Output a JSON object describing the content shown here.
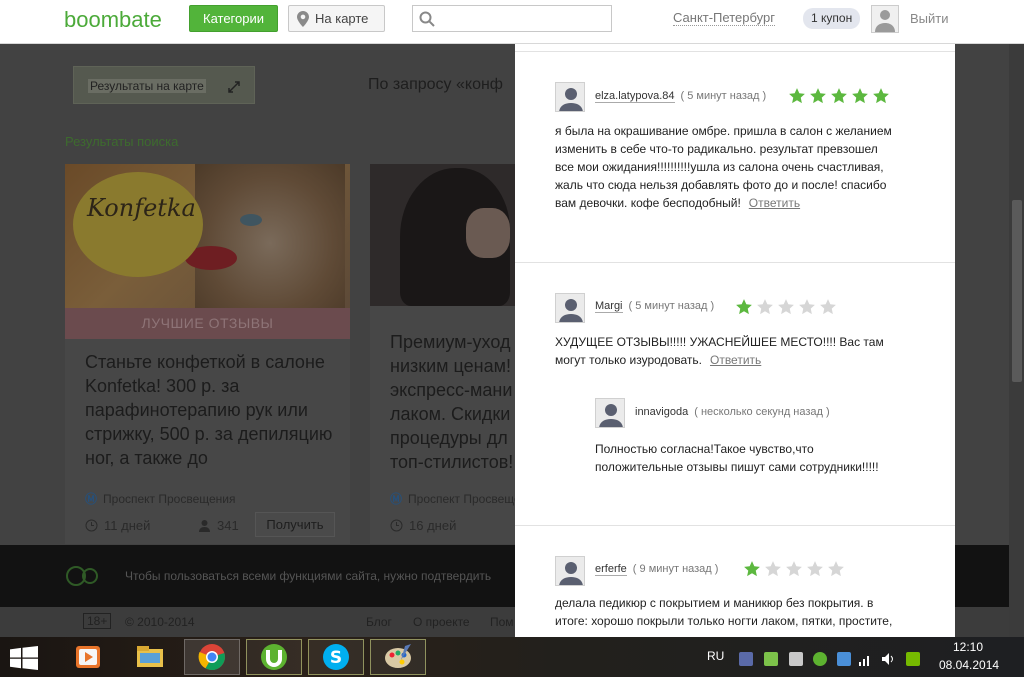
{
  "header": {
    "logo": "boombate",
    "categories_button": "Категории",
    "map_button": "На карте",
    "search_placeholder": "",
    "city": "Санкт-Петербург",
    "coupon": "1 купон",
    "logout": "Выйти",
    "accent_color": "#52b43a"
  },
  "background_page": {
    "map_label": "Результаты на карте",
    "query_text": "По запросу «конф",
    "results_label": "Результаты поиска",
    "cards": [
      {
        "badge": "ЛУЧШИЕ ОТЗЫВЫ",
        "image_text": "Konfetka",
        "title": "Станьте конфеткой в салоне Konfetka! 300 р. за парафинотерапию рук или стрижку, 500 р. за депиляцию ног, а также до",
        "metro": "Проспект Просвещения",
        "days": "11 дней",
        "count": "341",
        "button": "Получить"
      },
      {
        "title_lines": [
          "Премиум-уход",
          "низким ценам!",
          "экспресс-мани",
          "лаком. Скидки",
          "процедуры дл",
          "топ-стилистов!"
        ],
        "metro": "Проспект Просвеще",
        "days": "16 дней"
      }
    ],
    "confirm_text": "Чтобы пользоваться всеми функциями сайта, нужно подтвердить",
    "footer": {
      "age": "18+",
      "copyright": "© 2010-2014",
      "links": [
        "Блог",
        "О проекте",
        "Пом"
      ]
    }
  },
  "reviews": [
    {
      "user": "elza.latypova.84",
      "time": "( 5 минут назад )",
      "rating": 5,
      "lines": [
        "я была на окрашивание омбре. пришла в салон с желанием",
        "изменить в себе что-то радикально. результат превзошел",
        "все мои ожидания!!!!!!!!!!ушла из салона очень счастливая,",
        "жаль что сюда нельзя добавлять фото до и после! спасибо",
        "вам девочки. кофе бесподобный!"
      ],
      "reply": "Ответить"
    },
    {
      "user": "Margi",
      "time": "( 5 минут назад )",
      "rating": 1,
      "lines": [
        "ХУДУЩЕЕ ОТЗЫВЫ!!!!! УЖАСНЕЙШЕЕ МЕСТО!!!! Вас там",
        "могут только изуродовать."
      ],
      "reply": "Ответить",
      "answer": {
        "user": "innavigoda",
        "time": "( несколько секунд назад )",
        "lines": [
          "Полностью согласна!Такое чувство,что",
          "положительные отзывы пишут сами сотрудники!!!!!"
        ]
      }
    },
    {
      "user": "erferfe",
      "time": "( 9 минут назад )",
      "rating": 1,
      "lines": [
        "делала педикюр с покрытием и маникюр без покрытия. в",
        "итоге: хорошо покрыли только ногти лаком, пятки, простите,"
      ]
    }
  ],
  "star_colors": {
    "filled": "#5cb83f",
    "empty": "#d6d6d6"
  },
  "taskbar": {
    "language": "RU",
    "time": "12:10",
    "date": "08.04.2014",
    "apps": [
      "media-player",
      "file-explorer",
      "chrome",
      "utorrent",
      "skype",
      "paint"
    ]
  }
}
